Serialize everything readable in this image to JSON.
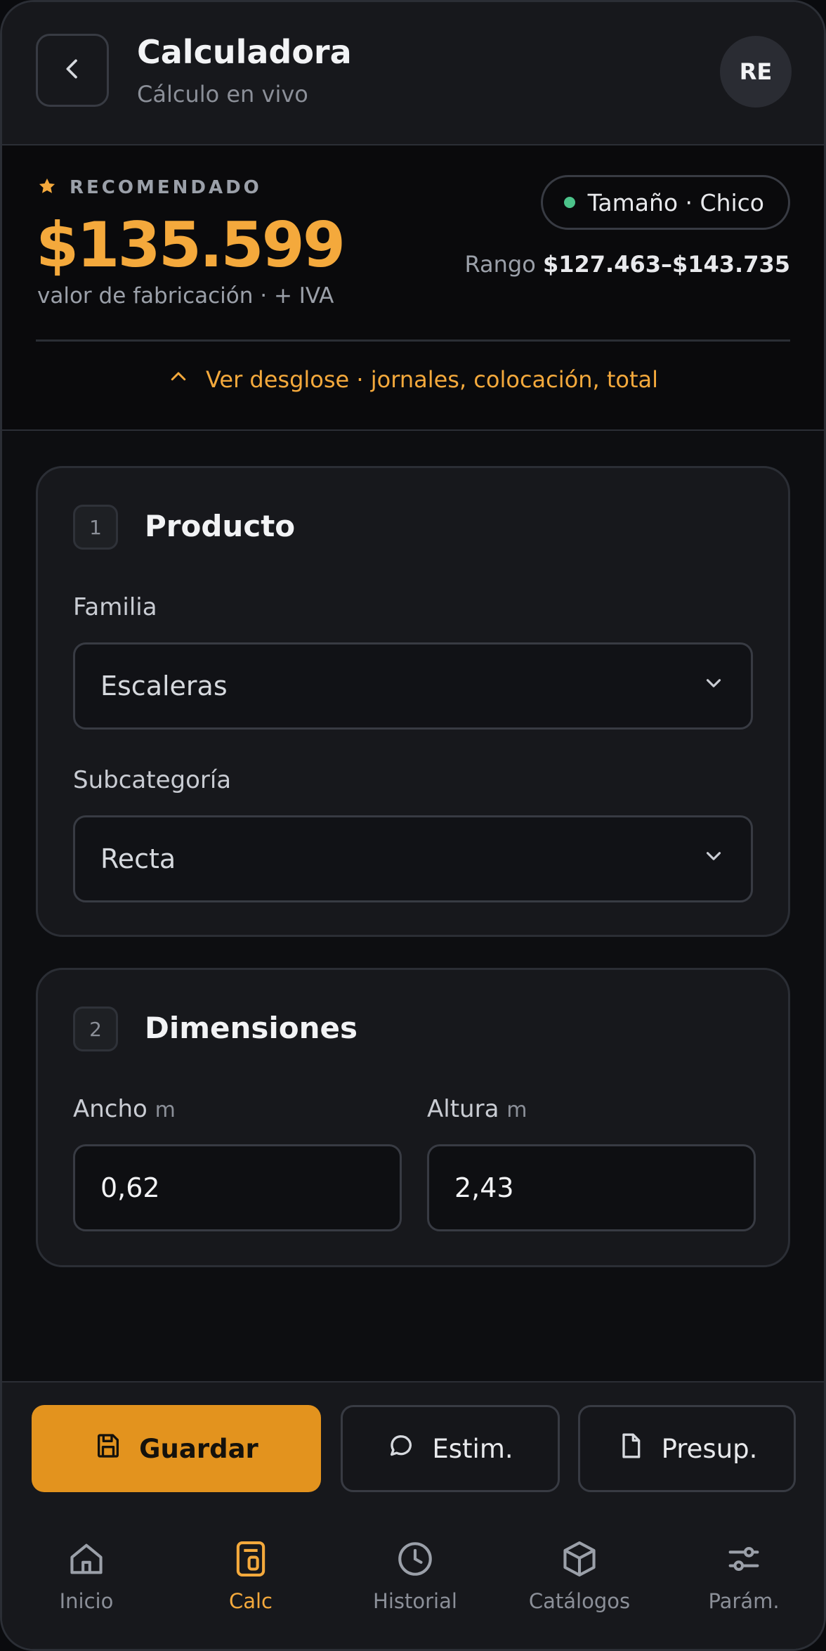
{
  "colors": {
    "accent": "#f4a93c",
    "primary_button": "#e3931e",
    "status_green": "#4cc38a",
    "background": "#0d0e11",
    "card": "#17181c"
  },
  "header": {
    "back_icon": "chevron-left-icon",
    "title": "Calculadora",
    "subtitle": "Cálculo en vivo",
    "avatar_initials": "RE"
  },
  "price": {
    "recommended_icon": "star-icon",
    "recommended_label": "RECOMENDADO",
    "value": "$135.599",
    "note": "valor de fabricación · + IVA",
    "size_label": "Tamaño · Chico",
    "range_label": "Rango",
    "range_value": "$127.463–$143.735",
    "breakdown_icon": "chevron-up-icon",
    "breakdown_label": "Ver desglose · jornales, colocación, total"
  },
  "product": {
    "step": "1",
    "title": "Producto",
    "family_label": "Familia",
    "family_value": "Escaleras",
    "subcategory_label": "Subcategoría",
    "subcategory_value": "Recta"
  },
  "dimensions": {
    "step": "2",
    "title": "Dimensiones",
    "width_label": "Ancho",
    "width_unit": "m",
    "width_value": "0,62",
    "height_label": "Altura",
    "height_unit": "m",
    "height_value": "2,43"
  },
  "actions": {
    "save_label": "Guardar",
    "save_icon": "save-icon",
    "estimate_label": "Estim.",
    "estimate_icon": "chat-icon",
    "quote_label": "Presup.",
    "quote_icon": "document-icon"
  },
  "nav": {
    "items": [
      {
        "label": "Inicio",
        "icon": "home-icon"
      },
      {
        "label": "Calc",
        "icon": "calculator-icon",
        "active": true
      },
      {
        "label": "Historial",
        "icon": "clock-icon"
      },
      {
        "label": "Catálogos",
        "icon": "box-icon"
      },
      {
        "label": "Parám.",
        "icon": "sliders-icon"
      }
    ]
  }
}
